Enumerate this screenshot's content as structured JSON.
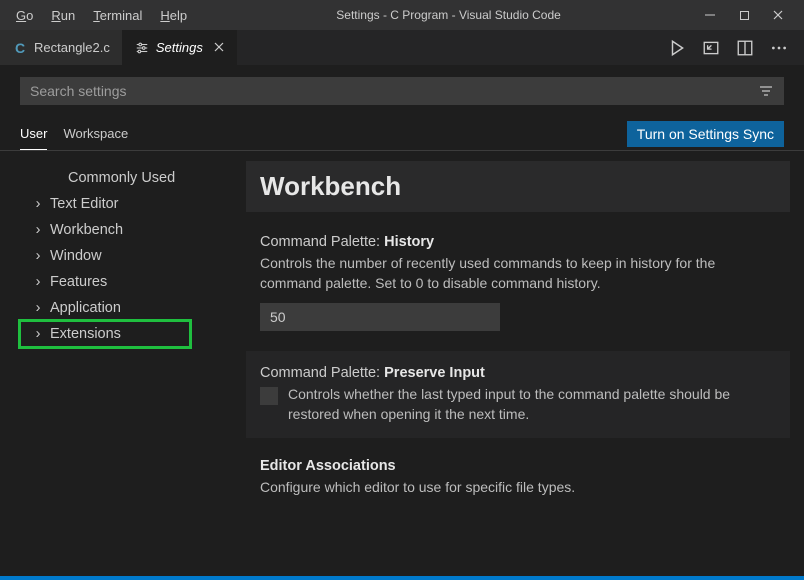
{
  "menu": {
    "go": "Go",
    "run": "Run",
    "terminal": "Terminal",
    "help": "Help"
  },
  "title": "Settings - C Program - Visual Studio Code",
  "tabs": {
    "file": "Rectangle2.c",
    "settings": "Settings"
  },
  "search": {
    "placeholder": "Search settings"
  },
  "scope": {
    "user": "User",
    "workspace": "Workspace",
    "sync": "Turn on Settings Sync"
  },
  "tree": {
    "commonly_used": "Commonly Used",
    "text_editor": "Text Editor",
    "workbench": "Workbench",
    "window": "Window",
    "features": "Features",
    "application": "Application",
    "extensions": "Extensions"
  },
  "content": {
    "header": "Workbench",
    "history": {
      "title_pre": "Command Palette: ",
      "title_bold": "History",
      "desc": "Controls the number of recently used commands to keep in history for the command palette. Set to 0 to disable command history.",
      "value": "50"
    },
    "preserve": {
      "title_pre": "Command Palette: ",
      "title_bold": "Preserve Input",
      "desc": "Controls whether the last typed input to the command palette should be restored when opening it the next time."
    },
    "assoc": {
      "title_bold": "Editor Associations",
      "desc": "Configure which editor to use for specific file types."
    }
  }
}
